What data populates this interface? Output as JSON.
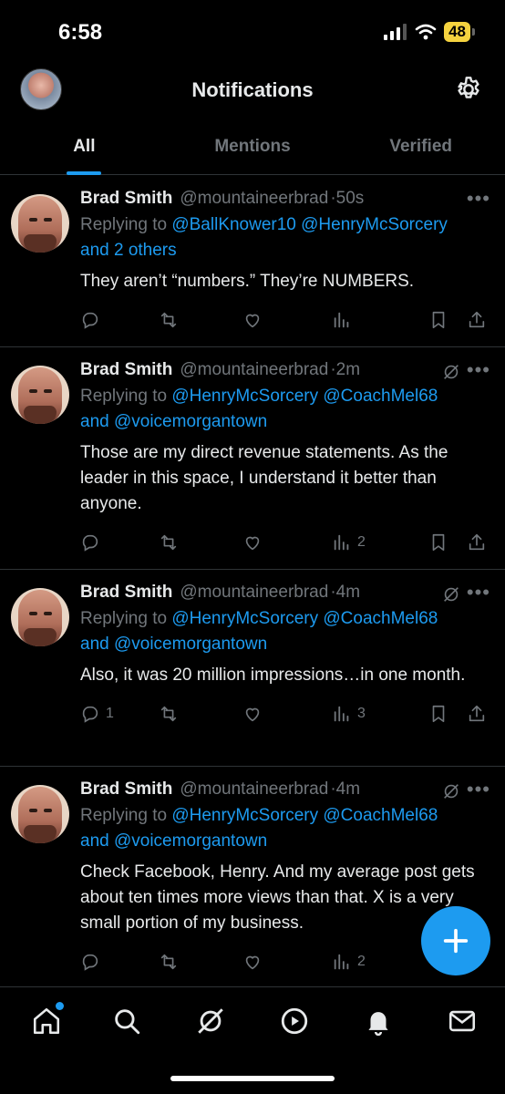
{
  "status_bar": {
    "time": "6:58",
    "battery": "48"
  },
  "header": {
    "title": "Notifications"
  },
  "tabs": [
    {
      "label": "All"
    },
    {
      "label": "Mentions"
    },
    {
      "label": "Verified"
    }
  ],
  "tweets": [
    {
      "name": "Brad Smith",
      "handle": "@mountaineerbrad",
      "time": "·50s",
      "replying_prefix": "Replying to ",
      "mentions_line1": "@BallKnower10 @HenryMcSorcery",
      "mentions_line2": "and 2 others",
      "body": "They aren’t “numbers.” They’re NUMBERS.",
      "reply_count": "",
      "views": ""
    },
    {
      "name": "Brad Smith",
      "handle": "@mountaineerbrad",
      "time": "·2m",
      "replying_prefix": "Replying to ",
      "mentions_line1": "@HenryMcSorcery @CoachMel68",
      "mentions_line2_prefix": "and ",
      "mentions_line2": "@voicemorgantown",
      "body": "Those are my direct revenue statements. As the leader in this space, I understand it better than anyone.",
      "reply_count": "",
      "views": "2"
    },
    {
      "name": "Brad Smith",
      "handle": "@mountaineerbrad",
      "time": "·4m",
      "replying_prefix": "Replying to ",
      "mentions_line1": "@HenryMcSorcery @CoachMel68",
      "mentions_line2_prefix": "and ",
      "mentions_line2": "@voicemorgantown",
      "body": "Also, it was 20 million impressions…in one month.",
      "reply_count": "1",
      "views": "3"
    },
    {
      "name": "Brad Smith",
      "handle": "@mountaineerbrad",
      "time": "·4m",
      "replying_prefix": "Replying to ",
      "mentions_line1": "@HenryMcSorcery @CoachMel68",
      "mentions_line2_prefix": "and ",
      "mentions_line2": "@voicemorgantown",
      "body": "Check Facebook, Henry. And my average post gets about ten times more views than that. X is a very small portion of my business.",
      "reply_count": "",
      "views": "2"
    }
  ],
  "icons": {
    "reply": "reply-icon",
    "repost": "repost-icon",
    "like": "heart-icon",
    "views": "views-icon",
    "bookmark": "bookmark-icon",
    "share": "share-icon",
    "grok": "grok-icon",
    "more": "more-icon"
  },
  "colors": {
    "accent": "#1d9bf0",
    "text": "#e7e9ea",
    "muted": "#71767b",
    "battery": "#f5d33f"
  }
}
